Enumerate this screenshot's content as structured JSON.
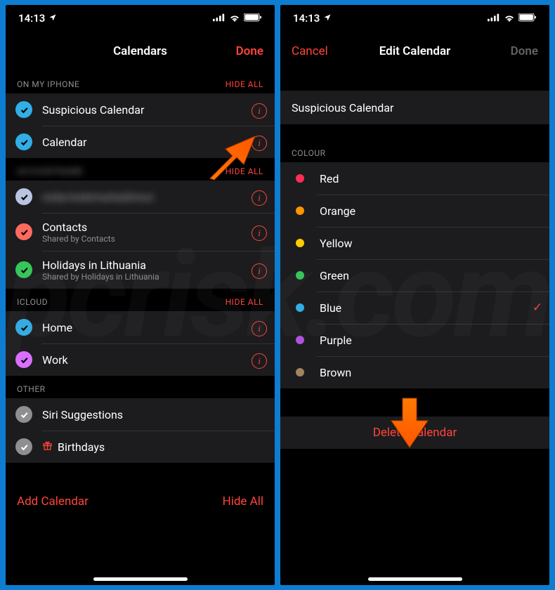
{
  "status": {
    "time": "14:13"
  },
  "screen1": {
    "title": "Calendars",
    "done_label": "Done",
    "sections": {
      "onmy": {
        "label": "ON MY IPHONE",
        "action": "HIDE ALL",
        "items": [
          {
            "name": "Suspicious Calendar",
            "color": "#32ade6"
          },
          {
            "name": "Calendar",
            "color": "#32ade6"
          }
        ]
      },
      "acct": {
        "label": "(account)",
        "action": "HIDE ALL",
        "items": [
          {
            "name": "(redacted)",
            "color": "#b9c5e0"
          },
          {
            "name": "Contacts",
            "sub": "Shared by Contacts",
            "color": "#ff6a5f"
          },
          {
            "name": "Holidays in Lithuania",
            "sub": "Shared by Holidays in Lithuania",
            "color": "#34c759"
          }
        ]
      },
      "icloud": {
        "label": "ICLOUD",
        "action": "HIDE ALL",
        "items": [
          {
            "name": "Home",
            "color": "#32ade6"
          },
          {
            "name": "Work",
            "color": "#d96fff"
          }
        ]
      },
      "other": {
        "label": "OTHER",
        "items": [
          {
            "name": "Siri Suggestions"
          },
          {
            "name": "Birthdays",
            "icon": "gift"
          }
        ]
      }
    },
    "bottom": {
      "add": "Add Calendar",
      "hide": "Hide All"
    }
  },
  "screen2": {
    "cancel_label": "Cancel",
    "title": "Edit Calendar",
    "done_label": "Done",
    "name_value": "Suspicious Calendar",
    "colour_section": "COLOUR",
    "colours": [
      {
        "name": "Red",
        "hex": "#ff2d55"
      },
      {
        "name": "Orange",
        "hex": "#ff9500"
      },
      {
        "name": "Yellow",
        "hex": "#ffcc00"
      },
      {
        "name": "Green",
        "hex": "#34c759"
      },
      {
        "name": "Blue",
        "hex": "#32ade6",
        "selected": true
      },
      {
        "name": "Purple",
        "hex": "#af52de"
      },
      {
        "name": "Brown",
        "hex": "#a2845e"
      }
    ],
    "delete_label": "Delete Calendar"
  },
  "annotations": {
    "arrow1": "points to info icon",
    "arrow2": "points to Delete Calendar"
  }
}
